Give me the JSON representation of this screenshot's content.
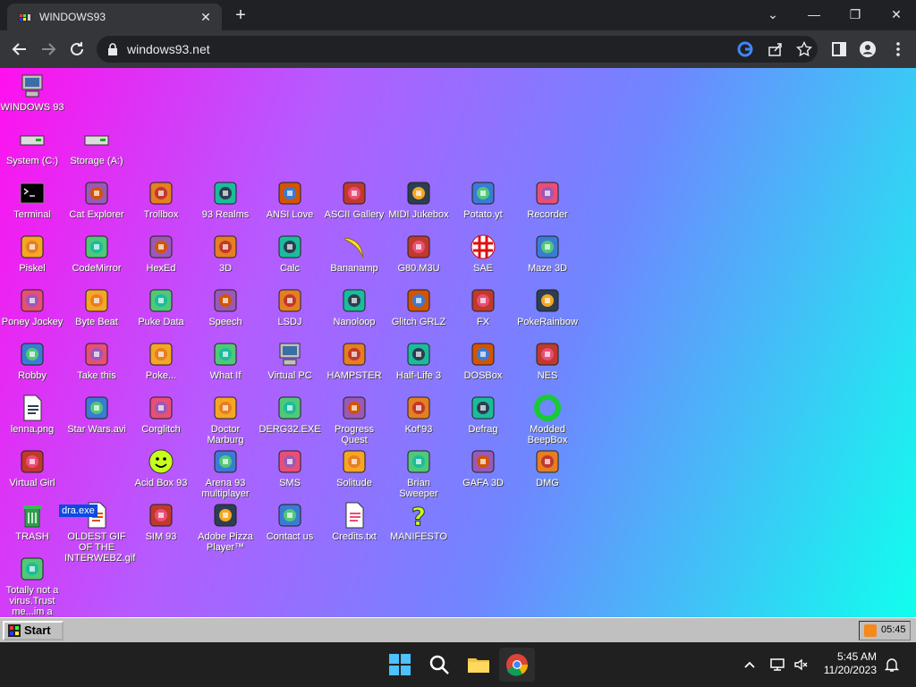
{
  "browser": {
    "tab_title": "WINDOWS93",
    "tab_close": "✕",
    "new_tab": "+",
    "url": "windows93.net",
    "window_controls": {
      "minimize": "—",
      "maximize": "❐",
      "close": "✕",
      "dropdown": "⌄"
    }
  },
  "desktop": {
    "icons": [
      {
        "label": "WINDOWS 93",
        "icon": "computer-icon"
      },
      {
        "label": "System (C:)",
        "icon": "drive-icon"
      },
      {
        "label": "Storage (A:)",
        "icon": "floppy-drive-icon"
      },
      {
        "label": "Terminal",
        "icon": "terminal-icon"
      },
      {
        "label": "Cat Explorer",
        "icon": "cat-globe-icon"
      },
      {
        "label": "Trollbox",
        "icon": "chat-bubble-icon"
      },
      {
        "label": "93 Realms",
        "icon": "realms-icon"
      },
      {
        "label": "ANSI Love",
        "icon": "ansi-icon"
      },
      {
        "label": "ASCII Gallery",
        "icon": "ascii-icon"
      },
      {
        "label": "MIDI Jukebox",
        "icon": "piano-icon"
      },
      {
        "label": "Potato.yt",
        "icon": "potato-icon"
      },
      {
        "label": "Recorder",
        "icon": "microphone-icon"
      },
      {
        "label": "Piskel",
        "icon": "palette-icon"
      },
      {
        "label": "CodeMirror",
        "icon": "codemirror-icon"
      },
      {
        "label": "HexEd",
        "icon": "hex-cube-icon"
      },
      {
        "label": "3D",
        "icon": "teapot-icon"
      },
      {
        "label": "Calc",
        "icon": "calculator-icon"
      },
      {
        "label": "Bananamp",
        "icon": "banana-icon"
      },
      {
        "label": "G80.M3U",
        "icon": "speaker-icon"
      },
      {
        "label": "SAE",
        "icon": "ball-icon"
      },
      {
        "label": "Maze 3D",
        "icon": "maze-icon"
      },
      {
        "label": "Poney Jockey",
        "icon": "pony-icon"
      },
      {
        "label": "Byte Beat",
        "icon": "bytebeat-icon"
      },
      {
        "label": "Puke Data",
        "icon": "pd-icon"
      },
      {
        "label": "Speech",
        "icon": "face-icon"
      },
      {
        "label": "LSDJ",
        "icon": "gameboy-icon"
      },
      {
        "label": "Nanoloop",
        "icon": "nanoloop-icon"
      },
      {
        "label": "Glitch GRLZ",
        "icon": "lips-icon"
      },
      {
        "label": "FX",
        "icon": "atom-icon"
      },
      {
        "label": "PokeRainbow",
        "icon": "pokerainbow-icon"
      },
      {
        "label": "Robby",
        "icon": "stickman-icon"
      },
      {
        "label": "Take this",
        "icon": "take-this-icon"
      },
      {
        "label": "Poke...",
        "icon": "poke-icon"
      },
      {
        "label": "What If",
        "icon": "whatif-icon"
      },
      {
        "label": "Virtual PC",
        "icon": "virtual-pc-icon"
      },
      {
        "label": "HAMPSTER",
        "icon": "hamster-icon"
      },
      {
        "label": "Half-Life 3",
        "icon": "lambda-icon"
      },
      {
        "label": "DOSBox",
        "icon": "dosbox-icon"
      },
      {
        "label": "NES",
        "icon": "nes-icon"
      },
      {
        "label": "lenna.png",
        "icon": "image-file-icon"
      },
      {
        "label": "Star Wars.avi",
        "icon": "yoda-icon"
      },
      {
        "label": "Corglitch",
        "icon": "corgi-icon"
      },
      {
        "label": "Doctor Marburg",
        "icon": "doctor-icon"
      },
      {
        "label": "DERG32.EXE",
        "icon": "derg-icon"
      },
      {
        "label": "Progress Quest",
        "icon": "swords-icon"
      },
      {
        "label": "Kof'93",
        "icon": "fighter-icon"
      },
      {
        "label": "Defrag",
        "icon": "defrag-icon"
      },
      {
        "label": "Modded BeepBox",
        "icon": "ring-icon"
      },
      {
        "label": "Virtual Girl",
        "icon": "virtual-girl-icon"
      },
      {
        "label": "Acid Box 93",
        "icon": "smiley-icon"
      },
      {
        "label": "Arena 93 multiplayer",
        "icon": "cube-icon"
      },
      {
        "label": "SMS",
        "icon": "sms-icon"
      },
      {
        "label": "Solitude",
        "icon": "solitude-icon"
      },
      {
        "label": "Brian Sweeper",
        "icon": "mine-icon"
      },
      {
        "label": "GAFA 3D",
        "icon": "gafa-icon"
      },
      {
        "label": "DMG",
        "icon": "dmg-icon"
      },
      {
        "label": "TRASH",
        "icon": "trash-icon"
      },
      {
        "label": "OLDEST GIF OF THE INTERWEBZ.gif",
        "icon": "gif-file-icon"
      },
      {
        "label": "SIM 93",
        "icon": "sim-icon"
      },
      {
        "label": "Adobe Pizza Player™",
        "icon": "pizza-icon"
      },
      {
        "label": "Contact us",
        "icon": "contact-icon"
      },
      {
        "label": "Credits.txt",
        "icon": "text-file-icon"
      },
      {
        "label": "MANIFESTO",
        "icon": "question-icon"
      },
      {
        "label": "Totally not a virus.Trust me...im a",
        "icon": "dolphin-icon"
      }
    ],
    "drag_tooltip": "dra.exe"
  },
  "taskbar93": {
    "start_label": "Start",
    "clock": "05:45"
  },
  "windows_taskbar": {
    "time": "5:45 AM",
    "date": "11/20/2023"
  },
  "colors": {
    "desktop_gradient_start": "#ff10ee",
    "desktop_gradient_end": "#10ffee",
    "chrome_bg": "#202124"
  }
}
